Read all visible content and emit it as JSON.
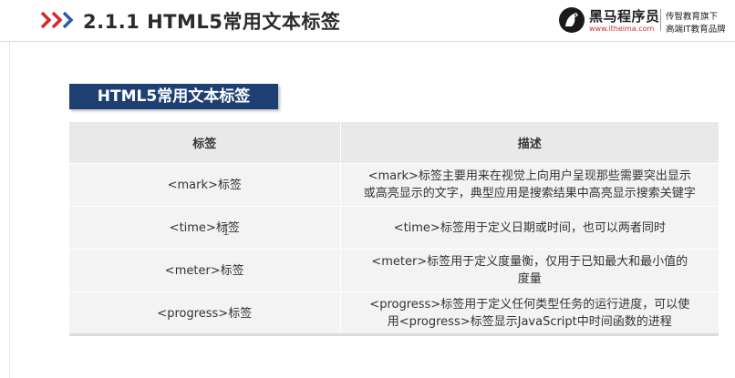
{
  "header": {
    "title": "2.1.1  HTML5常用文本标签",
    "logo": {
      "name": "黑马程序员",
      "url": "www.itheima.com",
      "tagline_1": "传智教育旗下",
      "tagline_2": "高端IT教育品牌"
    }
  },
  "badge": {
    "label": "HTML5常用文本标签"
  },
  "table": {
    "headers": [
      "标签",
      "描述"
    ],
    "rows": [
      {
        "tag": "<mark>标签",
        "desc_1": "<mark>标签主要用来在视觉上向用户呈现那些需要突出显示",
        "desc_2": "或高亮显示的文字，典型应用是搜索结果中高亮显示搜索关键字"
      },
      {
        "tag": "<time>标签",
        "desc_1": "<time>标签用于定义日期或时间，也可以两者同时",
        "desc_2": ""
      },
      {
        "tag": "<meter>标签",
        "desc_1": "<meter>标签用于定义度量衡，仅用于已知最大和最小值的",
        "desc_2": "度量"
      },
      {
        "tag": "<progress>标签",
        "desc_1": "<progress>标签用于定义任何类型任务的运行进度，可以使",
        "desc_2": "用<progress>标签显示JavaScript中时间函数的进程"
      }
    ]
  },
  "colors": {
    "badge_bg": "#1e3f72",
    "chevron_red": "#d7262a",
    "chevron_blue": "#2a5ba8"
  }
}
